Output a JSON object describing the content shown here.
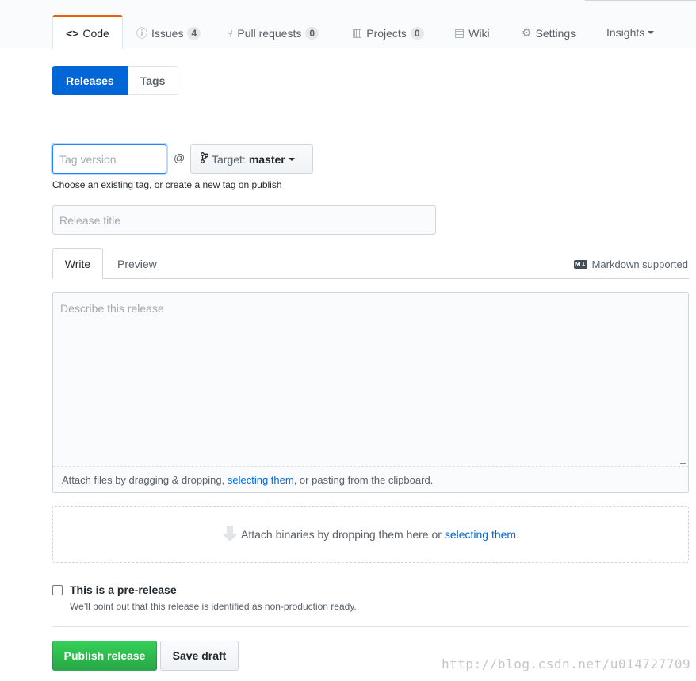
{
  "repo_nav": {
    "tabs": [
      {
        "label": "Code",
        "icon": "code-icon",
        "glyph": "<>"
      },
      {
        "label": "Issues",
        "icon": "issue-icon",
        "glyph": "ⓘ",
        "counter": "4"
      },
      {
        "label": "Pull requests",
        "icon": "pull-request-icon",
        "glyph": "⑂",
        "counter": "0"
      },
      {
        "label": "Projects",
        "icon": "project-icon",
        "glyph": "▥",
        "counter": "0"
      },
      {
        "label": "Wiki",
        "icon": "book-icon",
        "glyph": "▤"
      },
      {
        "label": "Settings",
        "icon": "gear-icon",
        "glyph": "⚙"
      },
      {
        "label": "Insights"
      }
    ],
    "selected": "Code",
    "accent_color": "#e36209"
  },
  "subnav": {
    "releases_label": "Releases",
    "tags_label": "Tags",
    "selected_color": "#0366d6"
  },
  "release_form": {
    "tag_placeholder": "Tag version",
    "tag_value": "",
    "at_symbol": "@",
    "target_prefix": "Target:",
    "target_branch": "master",
    "tag_note": "Choose an existing tag, or create a new tag on publish",
    "title_placeholder": "Release title",
    "write_tab": "Write",
    "preview_tab": "Preview",
    "markdown_icon_text": "M↓",
    "markdown_supported": "Markdown supported",
    "body_placeholder": "Describe this release",
    "attach_files_prefix": "Attach files by dragging & dropping, ",
    "attach_files_link": "selecting them",
    "attach_files_suffix": ", or pasting from the clipboard.",
    "binaries_prefix": "Attach binaries by dropping them here or ",
    "binaries_link": "selecting them",
    "binaries_suffix": ".",
    "prerelease_label": "This is a pre-release",
    "prerelease_checked": false,
    "prerelease_note": "We’ll point out that this release is identified as non-production ready.",
    "publish_label": "Publish release",
    "save_draft_label": "Save draft",
    "publish_color": "#28a745",
    "link_color": "#0366d6"
  },
  "watermark": "http://blog.csdn.net/u014727709"
}
